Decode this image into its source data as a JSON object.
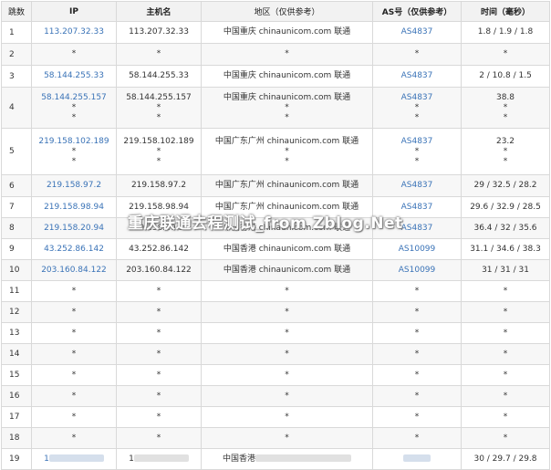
{
  "headers": {
    "hop": "跳数",
    "ip": "IP",
    "host": "主机名",
    "region": "地区（仅供参考）",
    "as": "AS号（仅供参考）",
    "time": "时间（毫秒）"
  },
  "rows": [
    {
      "hop": "1",
      "ip": [
        "113.207.32.33"
      ],
      "host": [
        "113.207.32.33"
      ],
      "region": [
        "中国重庆 chinaunicom.com 联通"
      ],
      "as": [
        "AS4837"
      ],
      "time": [
        "1.8 / 1.9 / 1.8"
      ]
    },
    {
      "hop": "2",
      "ip": [
        "*"
      ],
      "host": [
        "*"
      ],
      "region": [
        "*"
      ],
      "as": [
        "*"
      ],
      "time": [
        "*"
      ]
    },
    {
      "hop": "3",
      "ip": [
        "58.144.255.33"
      ],
      "host": [
        "58.144.255.33"
      ],
      "region": [
        "中国重庆 chinaunicom.com 联通"
      ],
      "as": [
        "AS4837"
      ],
      "time": [
        "2 / 10.8 / 1.5"
      ]
    },
    {
      "hop": "4",
      "ip": [
        "58.144.255.157",
        "*",
        "*"
      ],
      "host": [
        "58.144.255.157",
        "*",
        "*"
      ],
      "region": [
        "中国重庆 chinaunicom.com 联通",
        "*",
        "*"
      ],
      "as": [
        "AS4837",
        "*",
        "*"
      ],
      "time": [
        "38.8",
        "*",
        "*"
      ]
    },
    {
      "hop": "5",
      "ip": [
        "219.158.102.189",
        "*",
        "*"
      ],
      "host": [
        "219.158.102.189",
        "*",
        "*"
      ],
      "region": [
        "中国广东广州 chinaunicom.com 联通",
        "*",
        "*"
      ],
      "as": [
        "AS4837",
        "*",
        "*"
      ],
      "time": [
        "23.2",
        "*",
        "*"
      ]
    },
    {
      "hop": "6",
      "ip": [
        "219.158.97.2"
      ],
      "host": [
        "219.158.97.2"
      ],
      "region": [
        "中国广东广州 chinaunicom.com 联通"
      ],
      "as": [
        "AS4837"
      ],
      "time": [
        "29 / 32.5 / 28.2"
      ]
    },
    {
      "hop": "7",
      "ip": [
        "219.158.98.94"
      ],
      "host": [
        "219.158.98.94"
      ],
      "region": [
        "中国广东广州 chinaunicom.com 联通"
      ],
      "as": [
        "AS4837"
      ],
      "time": [
        "29.6 / 32.9 / 28.5"
      ]
    },
    {
      "hop": "8",
      "ip": [
        "219.158.20.94"
      ],
      "host": [
        "219.158.20.94"
      ],
      "region": [
        "中国香港 chinaunicom.com 联通"
      ],
      "as": [
        "AS4837"
      ],
      "time": [
        "36.4 / 32 / 35.6"
      ]
    },
    {
      "hop": "9",
      "ip": [
        "43.252.86.142"
      ],
      "host": [
        "43.252.86.142"
      ],
      "region": [
        "中国香港 chinaunicom.com 联通"
      ],
      "as": [
        "AS10099"
      ],
      "time": [
        "31.1 / 34.6 / 38.3"
      ]
    },
    {
      "hop": "10",
      "ip": [
        "203.160.84.122"
      ],
      "host": [
        "203.160.84.122"
      ],
      "region": [
        "中国香港 chinaunicom.com 联通"
      ],
      "as": [
        "AS10099"
      ],
      "time": [
        "31 / 31 / 31"
      ]
    },
    {
      "hop": "11",
      "ip": [
        "*"
      ],
      "host": [
        "*"
      ],
      "region": [
        "*"
      ],
      "as": [
        "*"
      ],
      "time": [
        "*"
      ]
    },
    {
      "hop": "12",
      "ip": [
        "*"
      ],
      "host": [
        "*"
      ],
      "region": [
        "*"
      ],
      "as": [
        "*"
      ],
      "time": [
        "*"
      ]
    },
    {
      "hop": "13",
      "ip": [
        "*"
      ],
      "host": [
        "*"
      ],
      "region": [
        "*"
      ],
      "as": [
        "*"
      ],
      "time": [
        "*"
      ]
    },
    {
      "hop": "14",
      "ip": [
        "*"
      ],
      "host": [
        "*"
      ],
      "region": [
        "*"
      ],
      "as": [
        "*"
      ],
      "time": [
        "*"
      ]
    },
    {
      "hop": "15",
      "ip": [
        "*"
      ],
      "host": [
        "*"
      ],
      "region": [
        "*"
      ],
      "as": [
        "*"
      ],
      "time": [
        "*"
      ]
    },
    {
      "hop": "16",
      "ip": [
        "*"
      ],
      "host": [
        "*"
      ],
      "region": [
        "*"
      ],
      "as": [
        "*"
      ],
      "time": [
        "*"
      ]
    },
    {
      "hop": "17",
      "ip": [
        "*"
      ],
      "host": [
        "*"
      ],
      "region": [
        "*"
      ],
      "as": [
        "*"
      ],
      "time": [
        "*"
      ]
    },
    {
      "hop": "18",
      "ip": [
        "*"
      ],
      "host": [
        "*"
      ],
      "region": [
        "*"
      ],
      "as": [
        "*"
      ],
      "time": [
        "*"
      ]
    },
    {
      "hop": "19",
      "ip": [
        "1"
      ],
      "host": [
        "1"
      ],
      "region": [
        "中国香港"
      ],
      "as": [
        ""
      ],
      "time": [
        "30 / 29.7 / 29.8"
      ],
      "redacted": true
    }
  ],
  "watermark": "重庆联通去程测试_from Zblog.Net",
  "colors": {
    "link": "#3a73b7",
    "header_bg": "#f2f2f2",
    "border": "#d9d9d9",
    "alt_row": "#f7f7f7"
  }
}
